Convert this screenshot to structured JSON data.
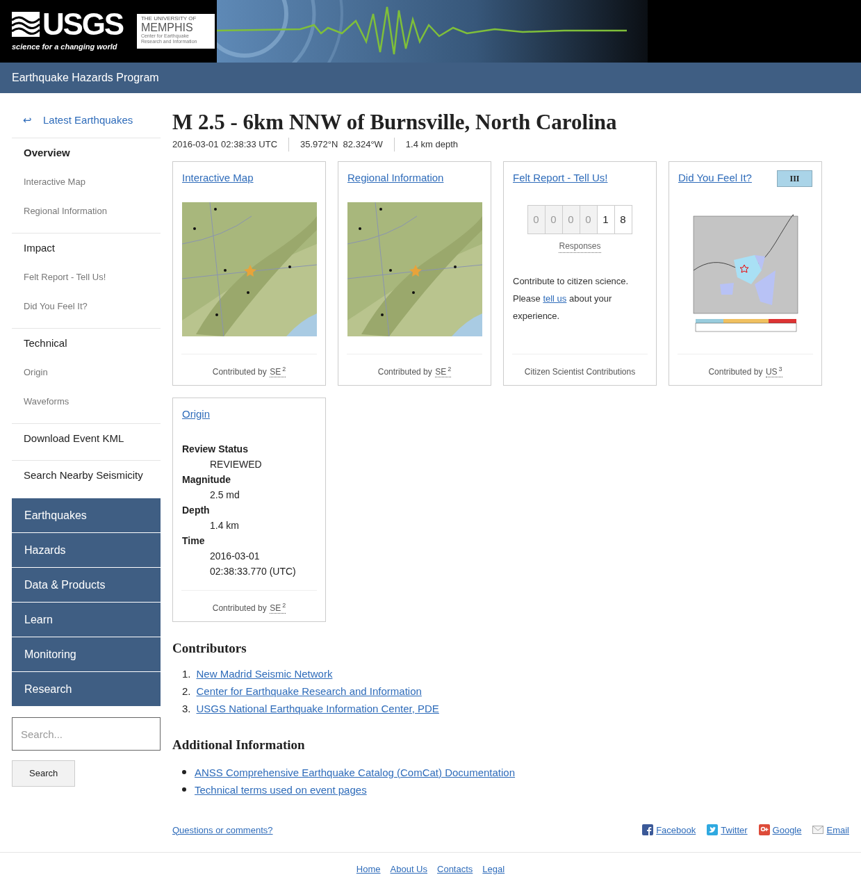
{
  "header": {
    "usgs_logo": {
      "wordmark": "USGS",
      "tagline": "science for a changing world"
    },
    "memphis_logo": {
      "line_1": "THE UNIVERSITY OF",
      "line_2": "MEMPHIS",
      "line_3": "Center for Earthquake Research and Information"
    },
    "program_title": "Earthquake Hazards Program"
  },
  "sidebar": {
    "back_link": {
      "icon": "↩",
      "label": "Latest Earthquakes"
    },
    "sections": [
      {
        "heading": "Overview",
        "selected": true,
        "items": [
          "Interactive Map",
          "Regional Information"
        ]
      },
      {
        "heading": "Impact",
        "selected": false,
        "items": [
          "Felt Report - Tell Us!",
          "Did You Feel It?"
        ]
      },
      {
        "heading": "Technical",
        "selected": false,
        "items": [
          "Origin",
          "Waveforms"
        ]
      },
      {
        "heading": "Download Event KML",
        "selected": false
      },
      {
        "heading": "Search Nearby Seismicity",
        "selected": false
      }
    ],
    "site_nav": [
      "Earthquakes",
      "Hazards",
      "Data & Products",
      "Learn",
      "Monitoring",
      "Research"
    ],
    "search": {
      "placeholder": "Search...",
      "button": "Search"
    }
  },
  "event": {
    "title": "M 2.5 - 6km NNW of Burnsville, North Carolina",
    "time": "2016-03-01 02:38:33 UTC",
    "location": "35.972°N  82.324°W",
    "depth": "1.4 km depth"
  },
  "cards": [
    {
      "kind": "map",
      "title": "Interactive Map",
      "contributed": "Contributed by",
      "source": "SE",
      "ref": "2"
    },
    {
      "kind": "map",
      "title": "Regional Information",
      "contributed": "Contributed by",
      "source": "SE",
      "ref": "2"
    },
    {
      "kind": "felt",
      "title": "Felt Report - Tell Us!",
      "digits": [
        {
          "text": "0",
          "muted": true
        },
        {
          "text": "0",
          "muted": true
        },
        {
          "text": "0",
          "muted": true
        },
        {
          "text": "0",
          "muted": true
        },
        {
          "text": "1",
          "muted": false
        },
        {
          "text": "8",
          "muted": false
        }
      ],
      "counter_label": "Responses",
      "line_1": "Contribute to citizen science.",
      "line_2_start": "Please",
      "line_2_link": "tell us",
      "line_2_end": "about your",
      "line_3": "experience.",
      "footer": "Citizen Scientist Contributions"
    },
    {
      "kind": "dyfi",
      "title": "Did You Feel It?",
      "badge": "III",
      "contributed": "Contributed by",
      "source": "US",
      "ref": "3"
    },
    {
      "kind": "origin",
      "title": "Origin",
      "fields": [
        {
          "label": "Review Status",
          "values": [
            "REVIEWED"
          ]
        },
        {
          "label": "Magnitude",
          "values": [
            "2.5 md"
          ]
        },
        {
          "label": "Depth",
          "values": [
            "1.4 km"
          ]
        },
        {
          "label": "Time",
          "values": [
            "2016-03-01",
            "02:38:33.770 (UTC)"
          ]
        }
      ],
      "contributed": "Contributed by",
      "source": "SE",
      "ref": "2"
    }
  ],
  "contributors": {
    "heading": "Contributors",
    "items": [
      {
        "number": "1.",
        "label": "New Madrid Seismic Network"
      },
      {
        "number": "2.",
        "label": "Center for Earthquake Research and Information"
      },
      {
        "number": "3.",
        "label": "USGS National Earthquake Information Center, PDE"
      }
    ]
  },
  "additional": {
    "heading": "Additional Information",
    "items": [
      "ANSS Comprehensive Earthquake Catalog (ComCat) Documentation",
      "Technical terms used on event pages"
    ]
  },
  "feedback_link": "Questions or comments?",
  "share": [
    {
      "kind": "facebook",
      "label": "Facebook"
    },
    {
      "kind": "twitter",
      "label": "Twitter"
    },
    {
      "kind": "google",
      "label": "Google"
    },
    {
      "kind": "email",
      "label": "Email"
    }
  ],
  "footer_links": [
    "Home",
    "About Us",
    "Contacts",
    "Legal"
  ]
}
